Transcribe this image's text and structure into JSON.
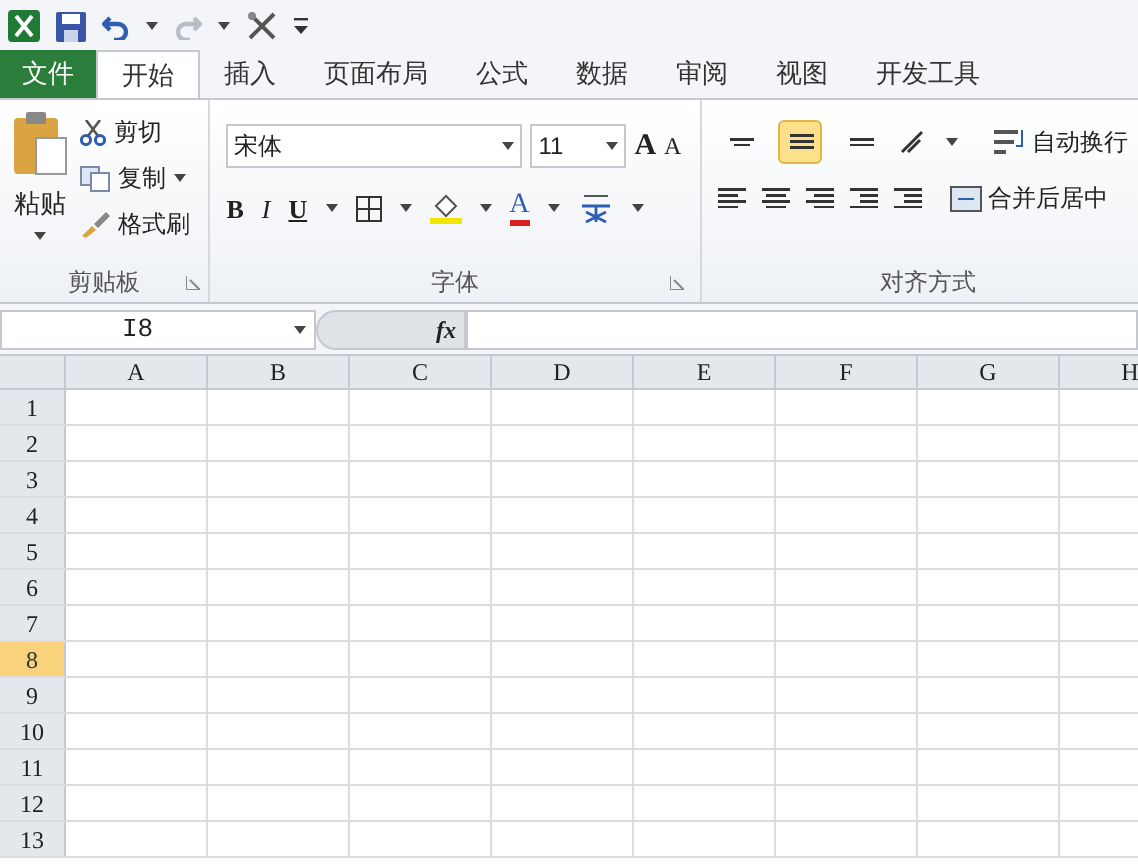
{
  "tabs": [
    {
      "label": "文件",
      "kind": "file",
      "selected": false
    },
    {
      "label": "开始",
      "kind": "tab",
      "selected": true
    },
    {
      "label": "插入",
      "kind": "tab",
      "selected": false
    },
    {
      "label": "页面布局",
      "kind": "tab",
      "selected": false
    },
    {
      "label": "公式",
      "kind": "tab",
      "selected": false
    },
    {
      "label": "数据",
      "kind": "tab",
      "selected": false
    },
    {
      "label": "审阅",
      "kind": "tab",
      "selected": false
    },
    {
      "label": "视图",
      "kind": "tab",
      "selected": false
    },
    {
      "label": "开发工具",
      "kind": "tab",
      "selected": false
    }
  ],
  "clipboard": {
    "paste": "粘贴",
    "cut": "剪切",
    "copy": "复制",
    "format_painter": "格式刷",
    "label": "剪贴板"
  },
  "font": {
    "name": "宋体",
    "size": "11",
    "grow": "A",
    "shrink": "A",
    "bold": "B",
    "italic": "I",
    "underline": "U",
    "font_color": "A",
    "label": "字体"
  },
  "alignment": {
    "vertical": [
      {
        "selected": false
      },
      {
        "selected": true
      },
      {
        "selected": false
      }
    ],
    "wrap": "自动换行",
    "merge": "合并后居中",
    "label": "对齐方式"
  },
  "formula_bar": {
    "name_box": "I8",
    "fx": "fx"
  },
  "columns": [
    "A",
    "B",
    "C",
    "D",
    "E",
    "F",
    "G",
    "H"
  ],
  "rows": [
    {
      "label": "1",
      "selected": false
    },
    {
      "label": "2",
      "selected": false
    },
    {
      "label": "3",
      "selected": false
    },
    {
      "label": "4",
      "selected": false
    },
    {
      "label": "5",
      "selected": false
    },
    {
      "label": "6",
      "selected": false
    },
    {
      "label": "7",
      "selected": false
    },
    {
      "label": "8",
      "selected": true
    },
    {
      "label": "9",
      "selected": false
    },
    {
      "label": "10",
      "selected": false
    },
    {
      "label": "11",
      "selected": false
    },
    {
      "label": "12",
      "selected": false
    },
    {
      "label": "13",
      "selected": false
    }
  ]
}
